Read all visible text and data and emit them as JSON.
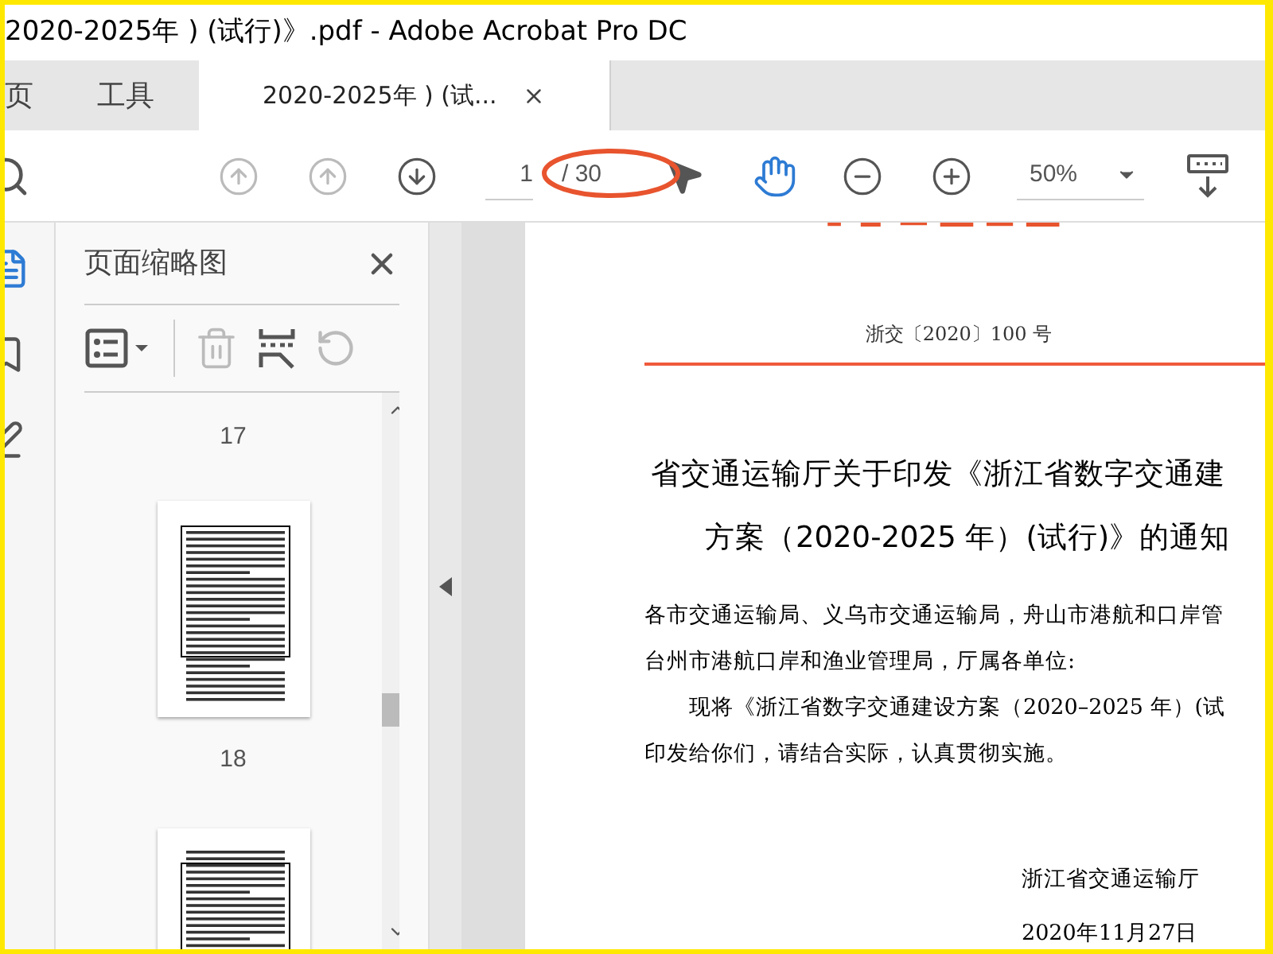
{
  "window": {
    "title": "2020-2025年 ) (试行)》.pdf - Adobe Acrobat Pro DC"
  },
  "tabs": [
    {
      "label": "页",
      "selected": false
    },
    {
      "label": "工具",
      "selected": false
    },
    {
      "label": "2020-2025年 ) (试...",
      "selected": true
    }
  ],
  "toolbar": {
    "page_number": "1",
    "page_total": "/ 30",
    "zoom": "50%"
  },
  "thumbnail_panel": {
    "title": "页面缩略图",
    "page_labels": [
      "17",
      "18"
    ]
  },
  "document": {
    "doc_number": "浙交〔2020〕100 号",
    "title_lines": [
      "省交通运输厅关于印发《浙江省数字交通建",
      "方案（2020-2025 年）(试行)》的通知"
    ],
    "addressee_lines": [
      "各市交通运输局、义乌市交通运输局，舟山市港航和口岸管",
      "台州市港航口岸和渔业管理局，厅属各单位:"
    ],
    "body_lines": [
      "现将《浙江省数字交通建设方案（2020–2025 年）(试",
      "印发给你们，请结合实际，认真贯彻实施。"
    ],
    "signature": "浙江省交通运输厅",
    "date": "2020年11月27日"
  }
}
